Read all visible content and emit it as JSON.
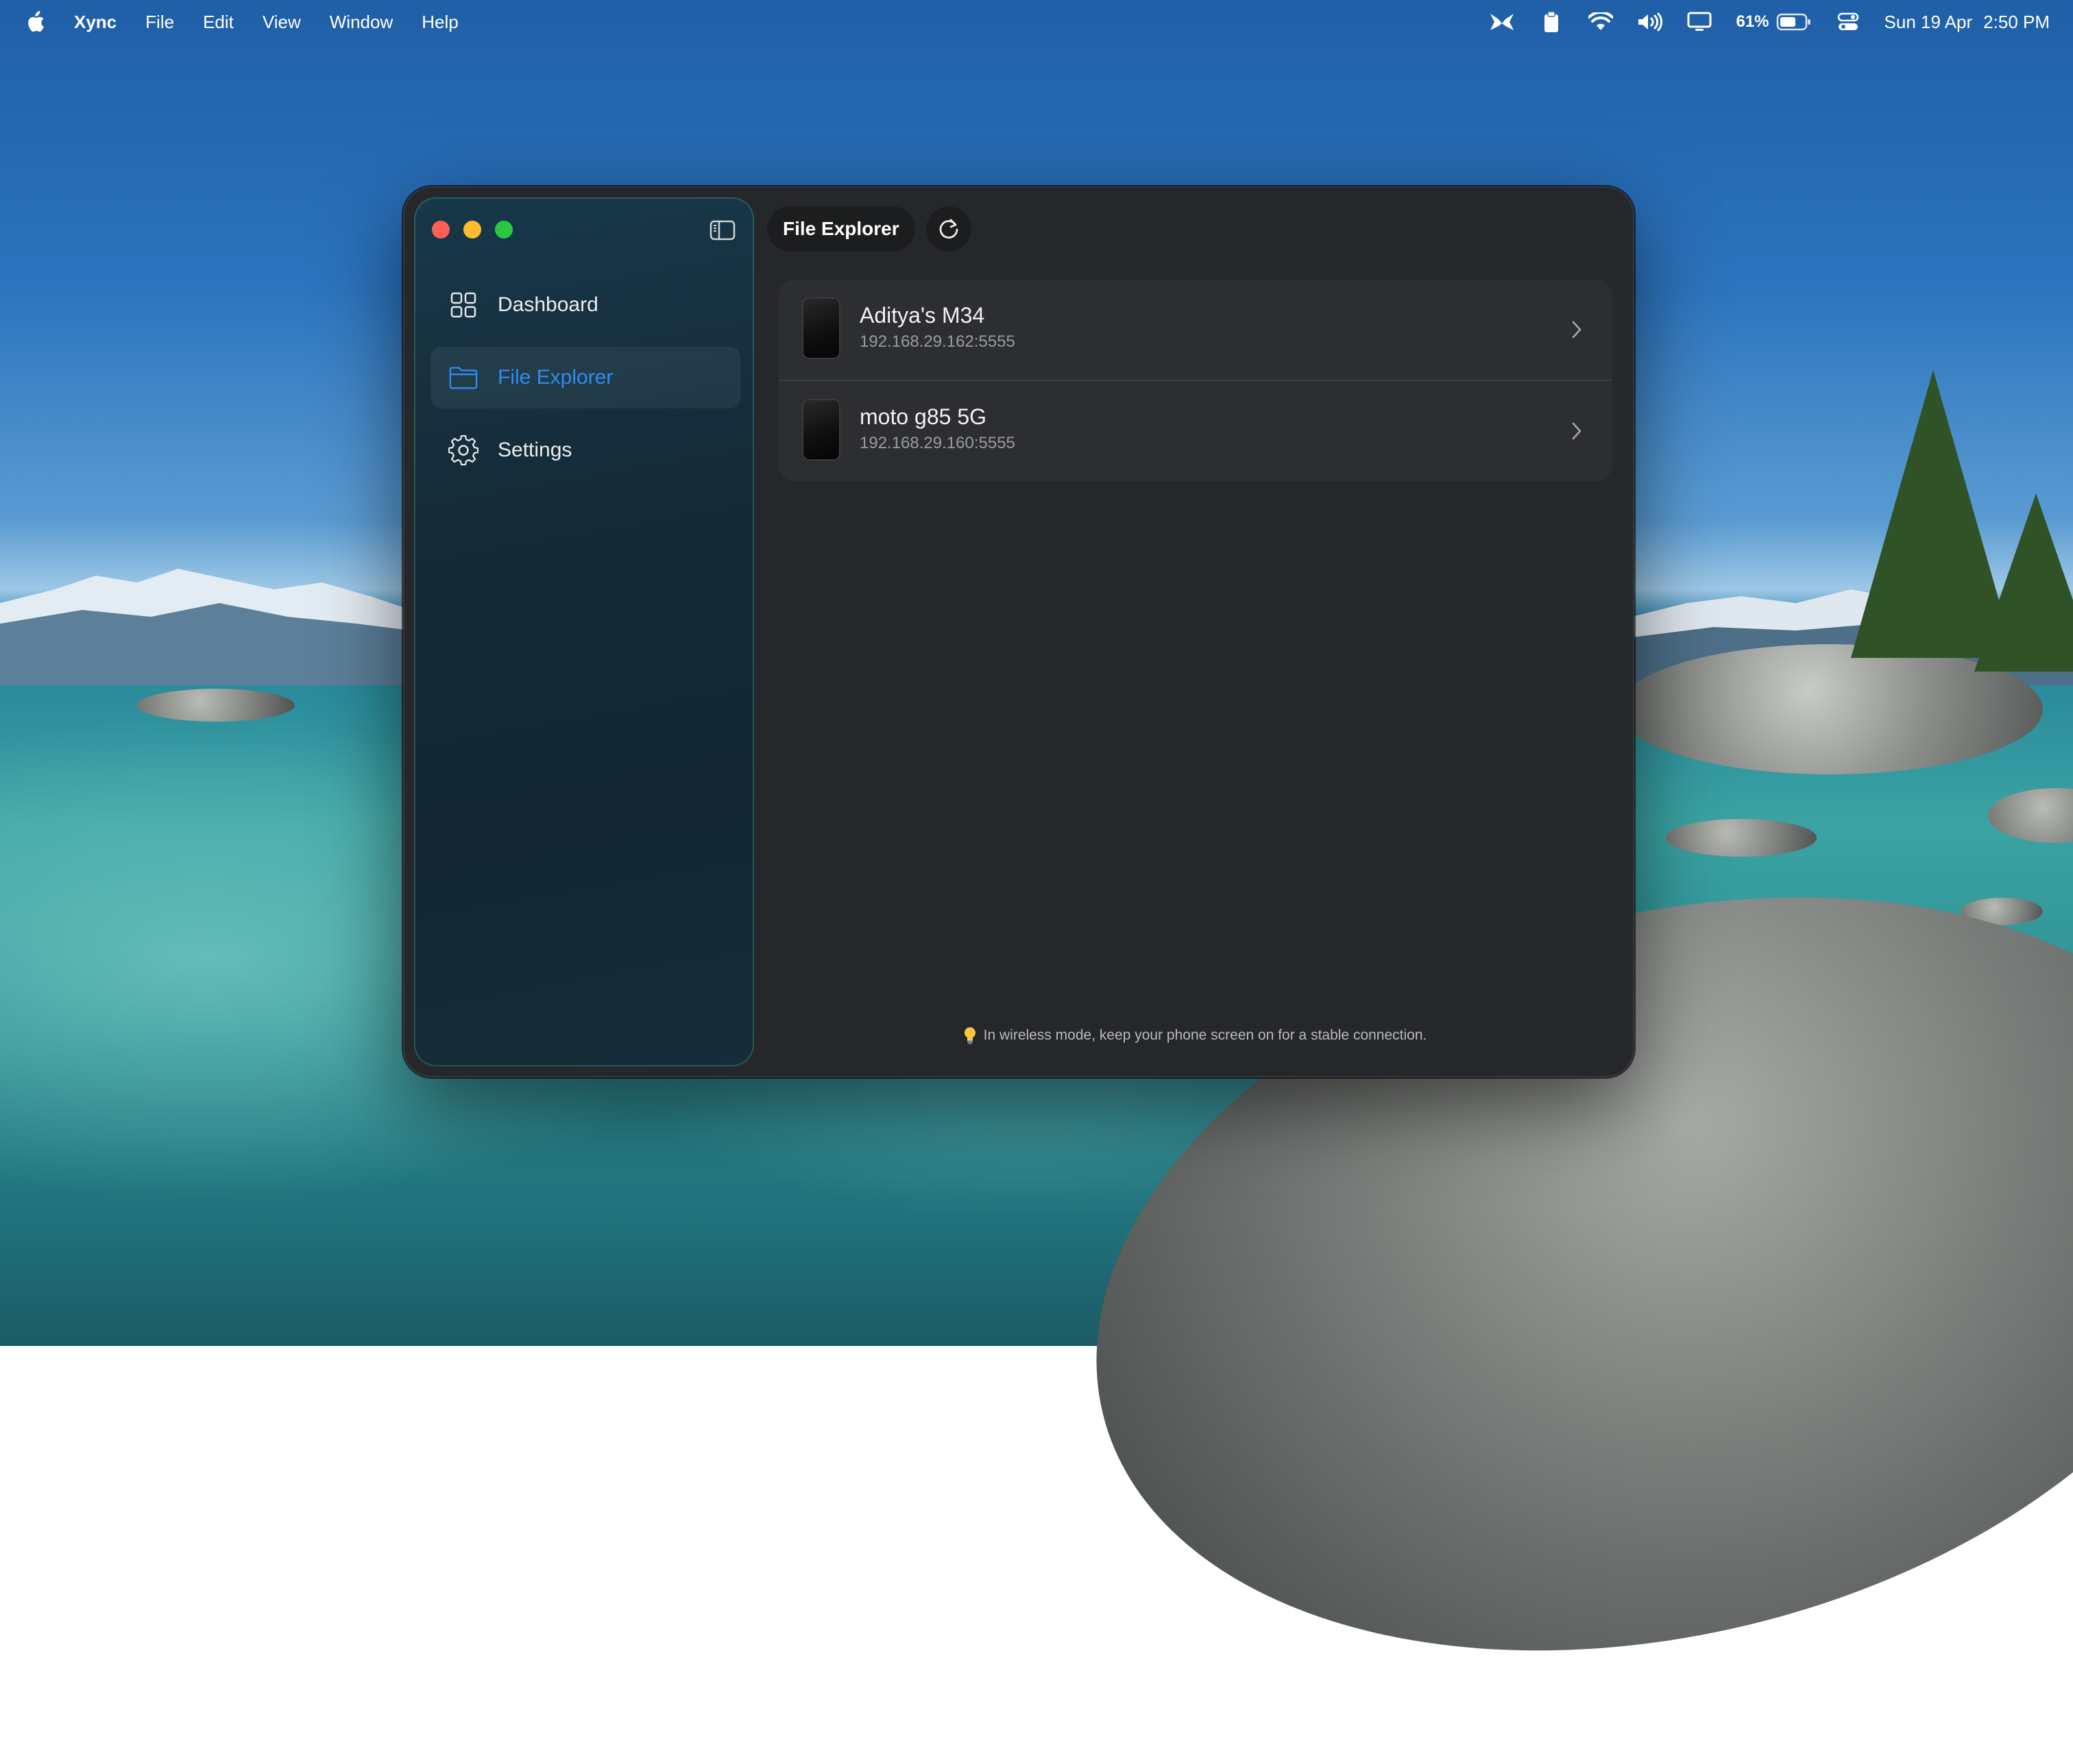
{
  "menubar": {
    "app_name": "Xync",
    "menus": [
      "File",
      "Edit",
      "View",
      "Window",
      "Help"
    ],
    "battery_percent": "61%",
    "date": "Sun 19 Apr",
    "time": "2:50 PM",
    "status_icons": [
      "xync-icon",
      "clipboard-icon",
      "wifi-icon",
      "volume-icon",
      "display-icon",
      "battery-icon",
      "control-center-icon"
    ]
  },
  "window": {
    "toolbar": {
      "title": "File Explorer",
      "refresh_icon": "refresh-icon"
    },
    "sidebar": {
      "items": [
        {
          "label": "Dashboard",
          "icon": "grid-icon",
          "active": false
        },
        {
          "label": "File Explorer",
          "icon": "folder-icon",
          "active": true
        },
        {
          "label": "Settings",
          "icon": "gear-icon",
          "active": false
        }
      ]
    },
    "devices": [
      {
        "name": "Aditya's M34",
        "address": "192.168.29.162:5555"
      },
      {
        "name": "moto g85 5G",
        "address": "192.168.29.160:5555"
      }
    ],
    "footer_tip": "In wireless mode, keep your phone screen on for a stable connection."
  },
  "colors": {
    "accent": "#2f8cf0",
    "window_bg": "#26272a",
    "traffic_close": "#fe5f57",
    "traffic_min": "#febc2e",
    "traffic_max": "#28c840"
  }
}
